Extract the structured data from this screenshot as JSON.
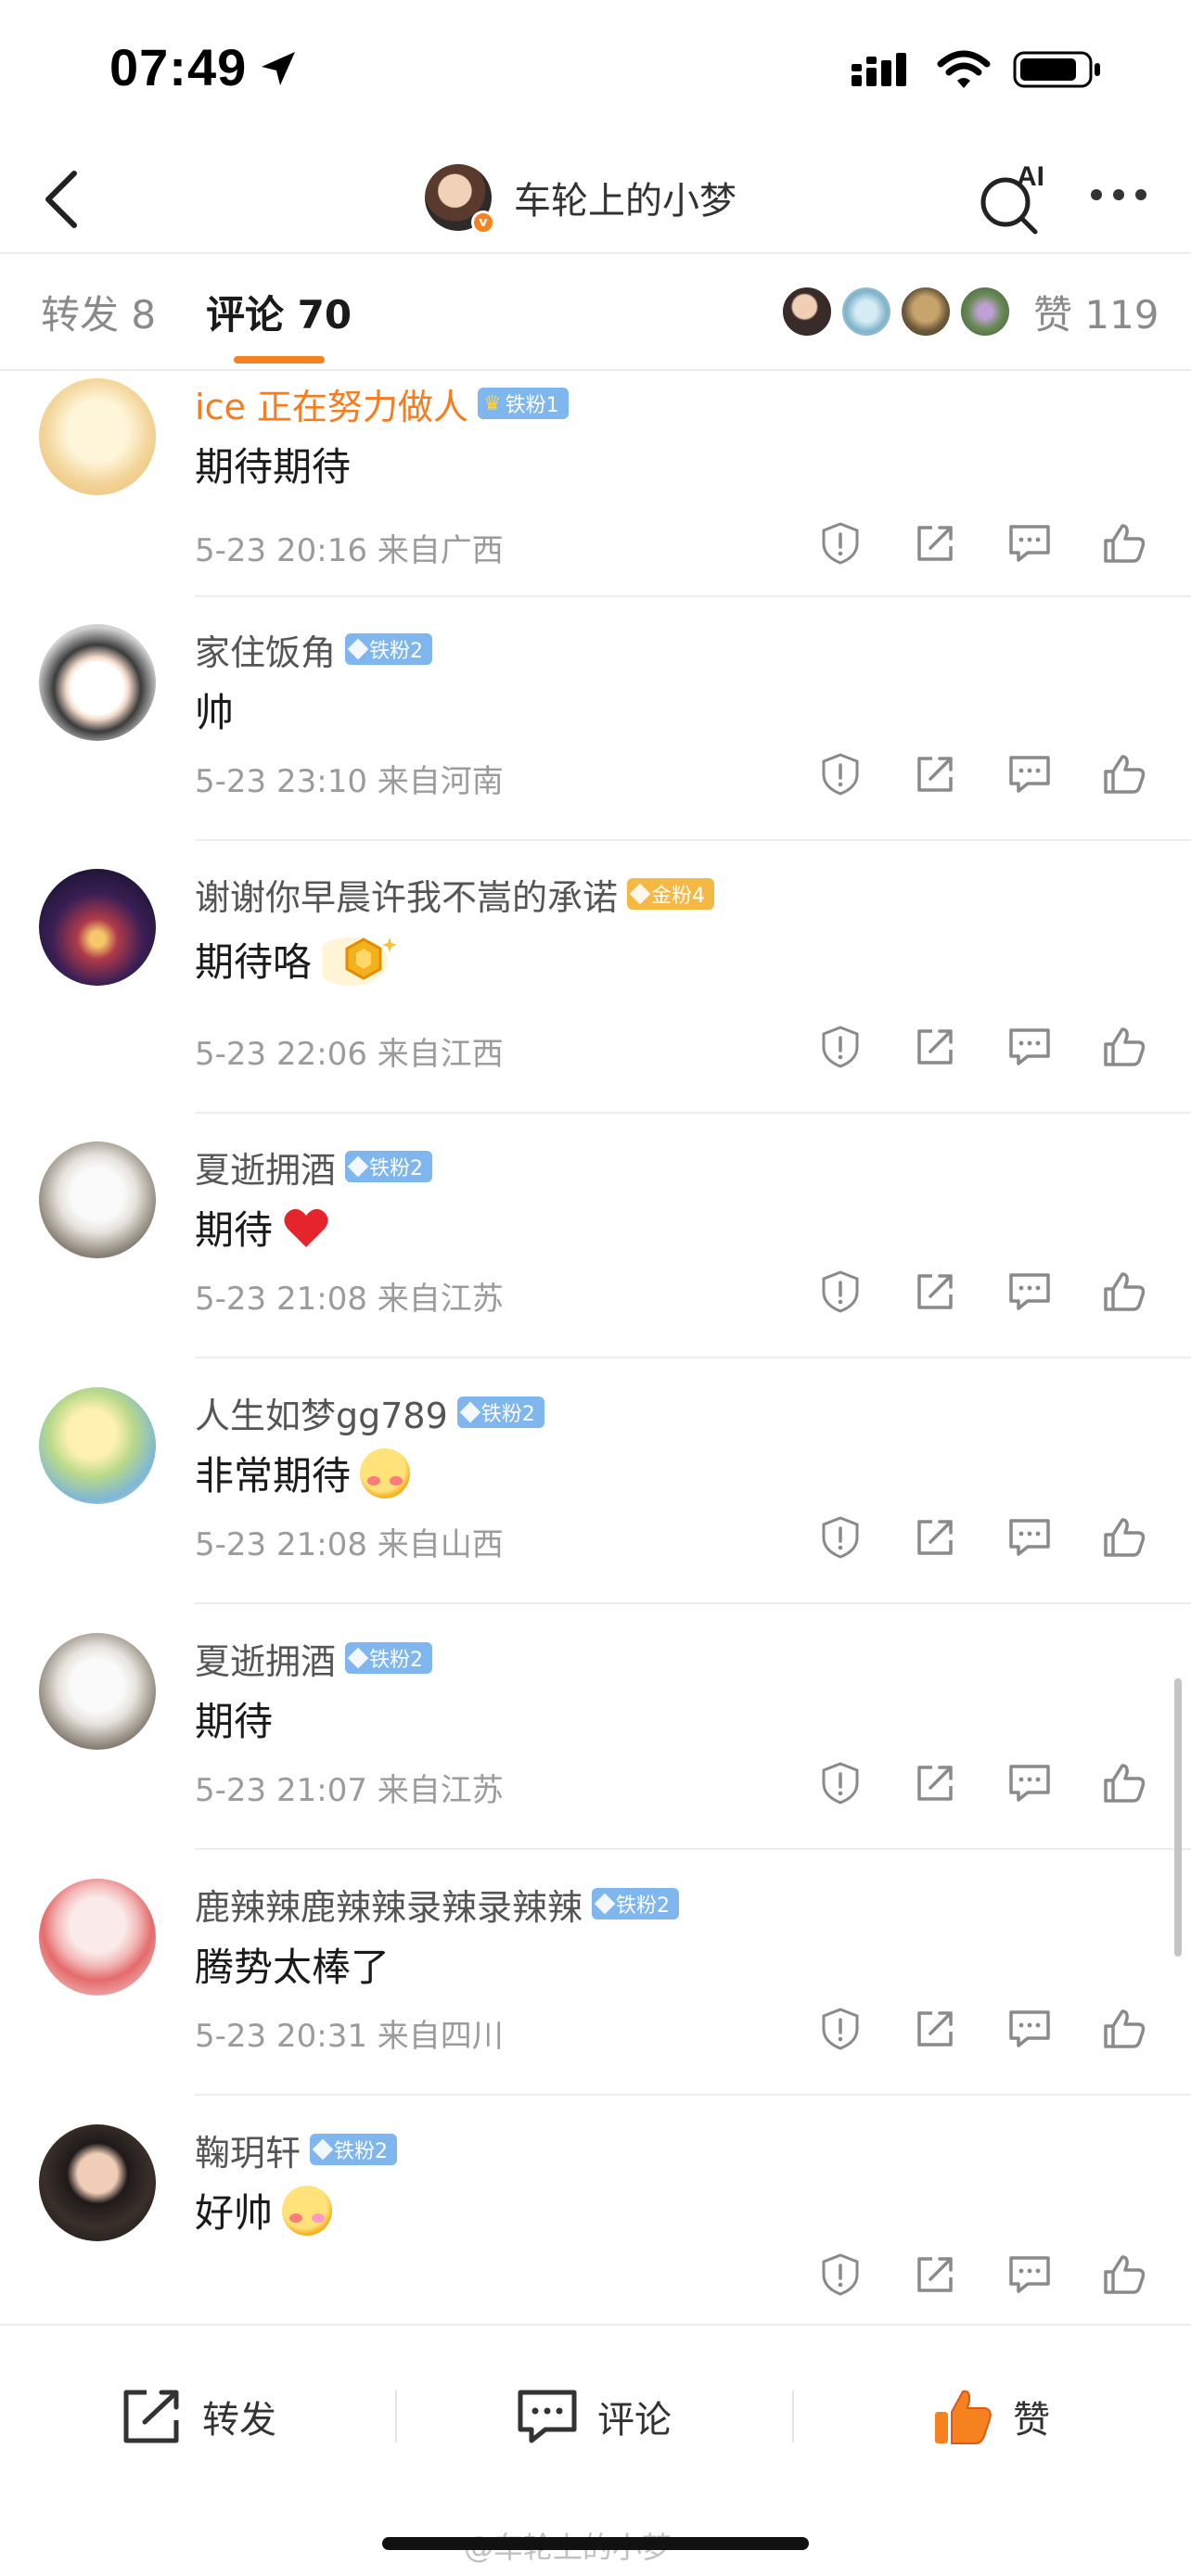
{
  "status_bar": {
    "time": "07:49"
  },
  "header": {
    "title": "车轮上的小梦",
    "ai_label": "AI"
  },
  "tabs": {
    "repost": "转发 8",
    "comment": "评论 70",
    "like": "赞 119"
  },
  "comments": [
    {
      "name": "ice 正在努力做人",
      "badge": "铁粉1",
      "badge_type": "crown",
      "text": "期待期待",
      "meta": "5-23 20:16  来自广西",
      "highlight": true
    },
    {
      "name": "家住饭角",
      "badge": "铁粉2",
      "badge_type": "iron",
      "text": "帅",
      "meta": "5-23 23:10  来自河南"
    },
    {
      "name": "谢谢你早晨许我不嵩的承诺",
      "badge": "金粉4",
      "badge_type": "gold",
      "text": "期待咯",
      "meta": "5-23 22:06  来自江西"
    },
    {
      "name": "夏逝拥酒",
      "badge": "铁粉2",
      "badge_type": "iron",
      "text": "期待",
      "meta": "5-23 21:08  来自江苏"
    },
    {
      "name": "人生如梦gg789",
      "badge": "铁粉2",
      "badge_type": "iron",
      "text": "非常期待",
      "meta": "5-23 21:08  来自山西"
    },
    {
      "name": "夏逝拥酒",
      "badge": "铁粉2",
      "badge_type": "iron",
      "text": "期待",
      "meta": "5-23 21:07  来自江苏"
    },
    {
      "name": "鹿辣辣鹿辣辣录辣录辣辣",
      "badge": "铁粉2",
      "badge_type": "iron",
      "text": "腾势太棒了",
      "meta": "5-23 20:31  来自四川"
    },
    {
      "name": "鞠玥轩",
      "badge": "铁粉2",
      "badge_type": "iron",
      "text": "好帅",
      "meta": ""
    }
  ],
  "bottom_bar": {
    "repost": "转发",
    "comment": "评论",
    "like": "赞"
  },
  "watermark": "@车轮上的小梦",
  "colors": {
    "accent": "#f6821f",
    "iron_badge": "#7fb6ee",
    "gold_badge": "#f5b842"
  }
}
